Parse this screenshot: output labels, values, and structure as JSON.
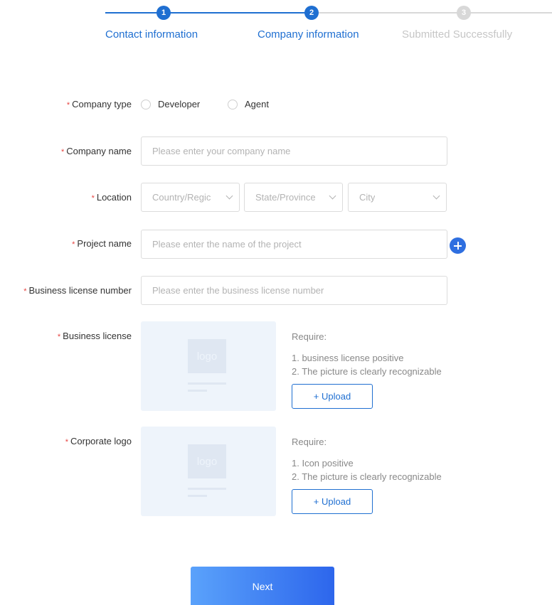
{
  "stepper": {
    "steps": [
      {
        "number": "1",
        "label": "Contact information",
        "state": "done"
      },
      {
        "number": "2",
        "label": "Company information",
        "state": "active"
      },
      {
        "number": "3",
        "label": "Submitted Successfully",
        "state": "pending"
      }
    ],
    "active_color": "#1f6fd1",
    "inactive_color": "#d8d8d8"
  },
  "form": {
    "required_mark": "*",
    "company_type": {
      "label": "Company type",
      "options": [
        "Developer",
        "Agent"
      ]
    },
    "company_name": {
      "label": "Company name",
      "placeholder": "Please enter your company name"
    },
    "location": {
      "label": "Location",
      "country_placeholder": "Country/Regic",
      "state_placeholder": "State/Province",
      "city_placeholder": "City"
    },
    "project_name": {
      "label": "Project name",
      "placeholder": "Please enter the name of the project",
      "add_icon": "plus-circle-icon"
    },
    "business_license_number": {
      "label": "Business license number",
      "placeholder": "Please enter the business license number"
    },
    "business_license": {
      "label": "Business license",
      "placeholder_logo_text": "logo",
      "require_title": "Require:",
      "requirements": [
        "1. business license positive",
        "2. The picture is clearly recognizable"
      ],
      "upload_label": "+ Upload"
    },
    "corporate_logo": {
      "label": "Corporate logo",
      "placeholder_logo_text": "logo",
      "require_title": "Require:",
      "requirements": [
        "1. Icon positive",
        "2. The picture is clearly recognizable"
      ],
      "upload_label": "+ Upload"
    }
  },
  "actions": {
    "next_label": "Next"
  }
}
